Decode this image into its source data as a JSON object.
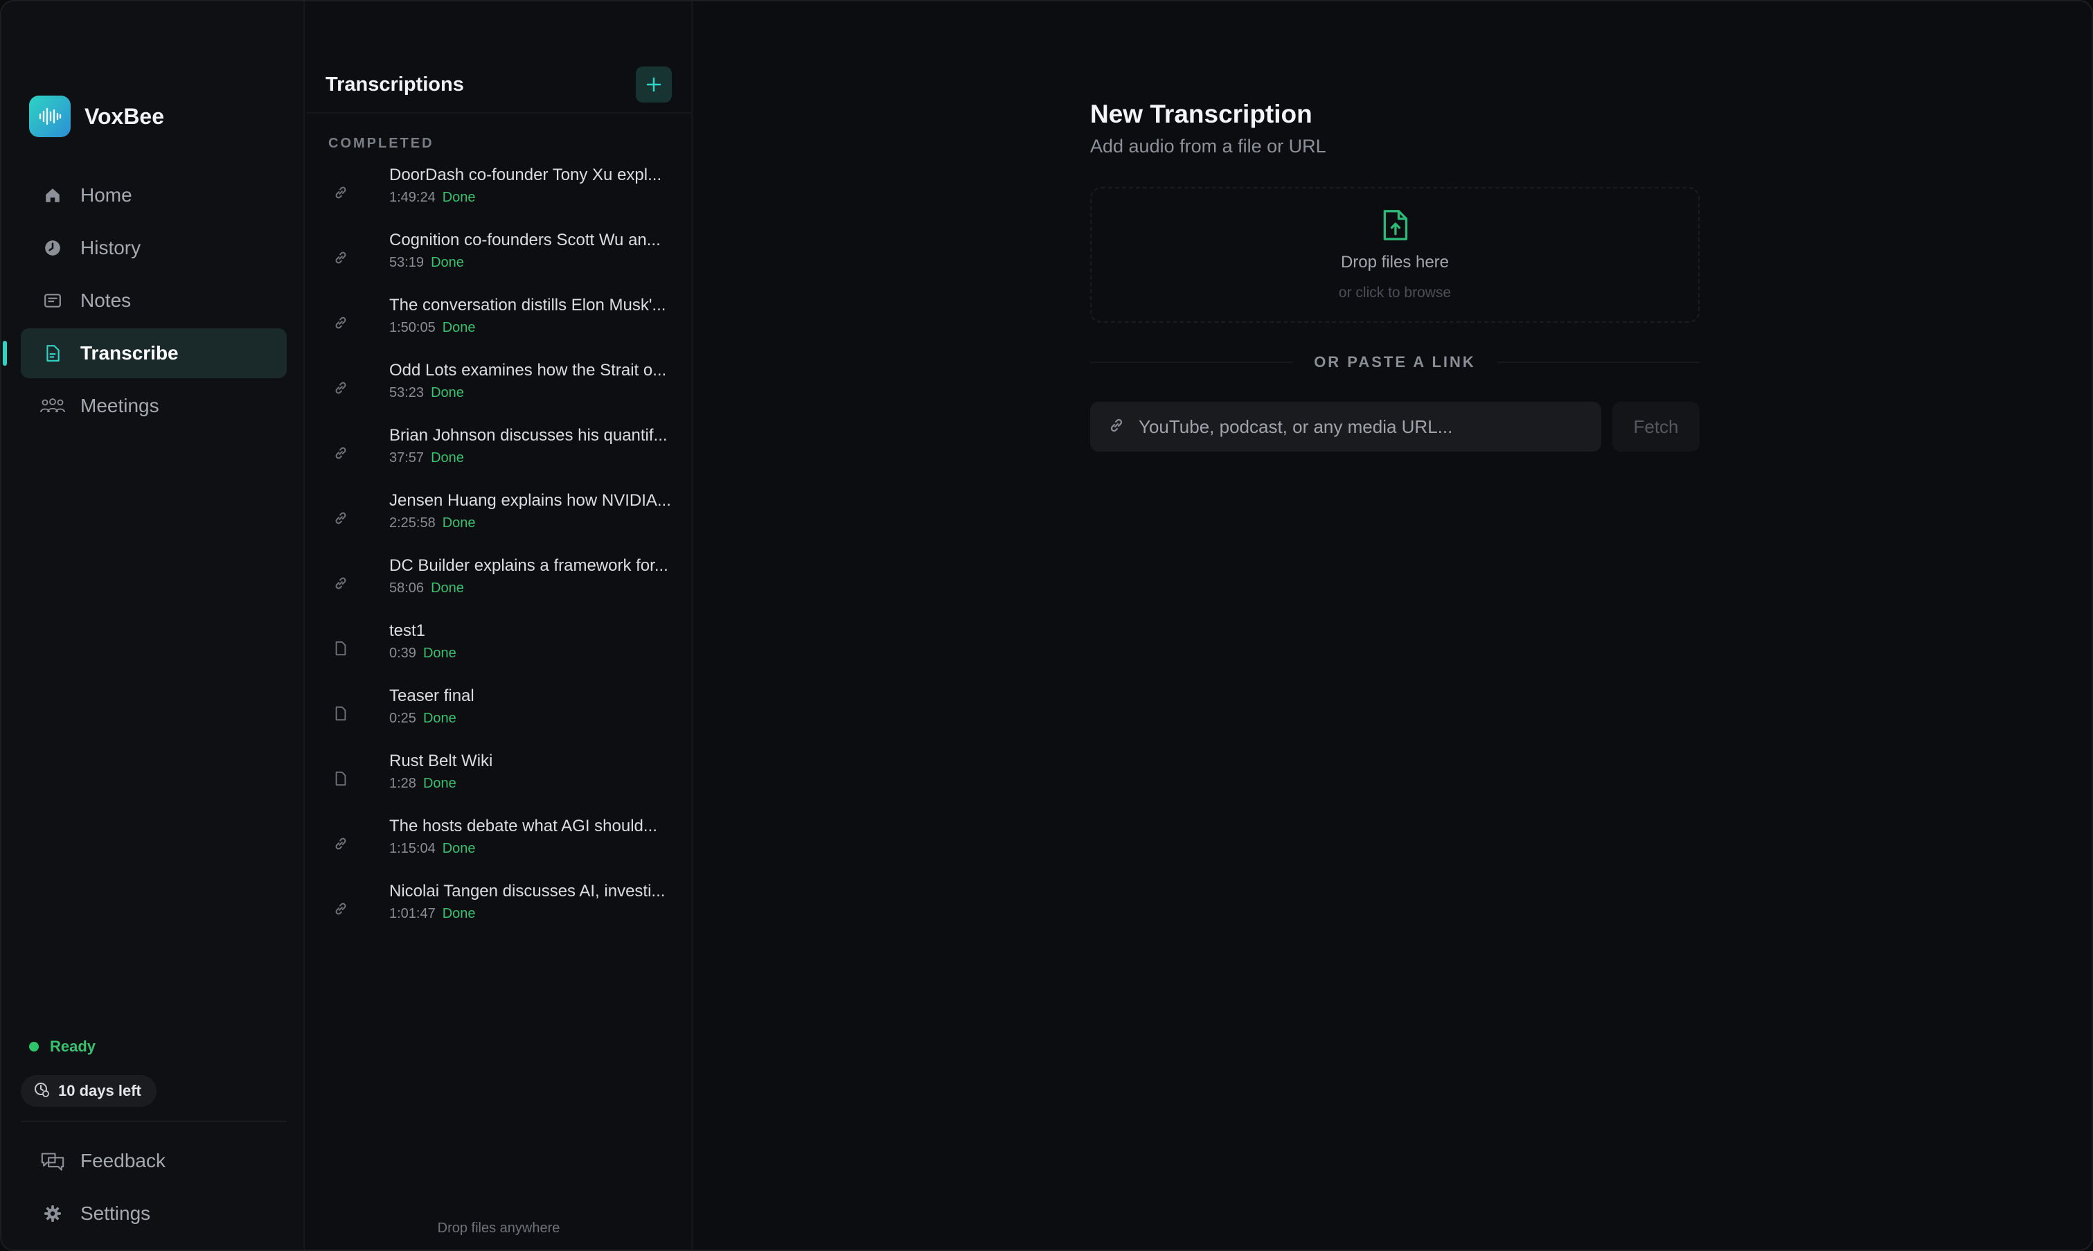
{
  "app": {
    "name": "VoxBee"
  },
  "sidebar": {
    "nav": [
      {
        "label": "Home",
        "icon": "home-icon"
      },
      {
        "label": "History",
        "icon": "clock-icon"
      },
      {
        "label": "Notes",
        "icon": "notes-icon"
      },
      {
        "label": "Transcribe",
        "icon": "document-icon",
        "active": true
      },
      {
        "label": "Meetings",
        "icon": "people-icon"
      }
    ],
    "status": "Ready",
    "trial": "10 days left",
    "bottom": [
      {
        "label": "Feedback",
        "icon": "feedback-icon"
      },
      {
        "label": "Settings",
        "icon": "gear-icon"
      }
    ]
  },
  "list": {
    "title": "Transcriptions",
    "section": "COMPLETED",
    "items": [
      {
        "title": "DoorDash co-founder Tony Xu expl...",
        "duration": "1:49:24",
        "status": "Done",
        "type": "link"
      },
      {
        "title": "Cognition co-founders Scott Wu an...",
        "duration": "53:19",
        "status": "Done",
        "type": "link"
      },
      {
        "title": "The conversation distills Elon Musk'...",
        "duration": "1:50:05",
        "status": "Done",
        "type": "link"
      },
      {
        "title": "Odd Lots examines how the Strait o...",
        "duration": "53:23",
        "status": "Done",
        "type": "link"
      },
      {
        "title": "Brian Johnson discusses his quantif...",
        "duration": "37:57",
        "status": "Done",
        "type": "link"
      },
      {
        "title": "Jensen Huang explains how NVIDIA...",
        "duration": "2:25:58",
        "status": "Done",
        "type": "link"
      },
      {
        "title": "DC Builder explains a framework for...",
        "duration": "58:06",
        "status": "Done",
        "type": "link"
      },
      {
        "title": "test1",
        "duration": "0:39",
        "status": "Done",
        "type": "file"
      },
      {
        "title": "Teaser final",
        "duration": "0:25",
        "status": "Done",
        "type": "file"
      },
      {
        "title": "Rust Belt Wiki",
        "duration": "1:28",
        "status": "Done",
        "type": "file"
      },
      {
        "title": "The hosts debate what AGI should...",
        "duration": "1:15:04",
        "status": "Done",
        "type": "link"
      },
      {
        "title": "Nicolai Tangen discusses AI, investi...",
        "duration": "1:01:47",
        "status": "Done",
        "type": "link"
      }
    ],
    "footer": "Drop files anywhere"
  },
  "main": {
    "title": "New Transcription",
    "subtitle": "Add audio from a file or URL",
    "dropzone": {
      "main": "Drop files here",
      "sub": "or click to browse"
    },
    "divider": "OR PASTE A LINK",
    "url": {
      "placeholder": "YouTube, podcast, or any media URL...",
      "value": ""
    },
    "fetch": "Fetch"
  },
  "colors": {
    "accent": "#2fd3c3",
    "done": "#3cc06f",
    "background": "#0d0e11"
  }
}
